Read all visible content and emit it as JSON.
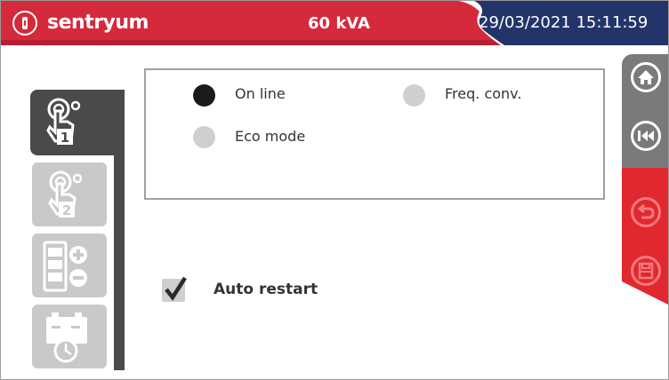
{
  "header": {
    "brand": "sentryum",
    "power": "60 kVA",
    "datetime": "29/03/2021 15:11:59"
  },
  "nav": {
    "items": [
      {
        "icon": "hand-touch-1-icon",
        "active": true
      },
      {
        "icon": "hand-touch-2-icon",
        "active": false
      },
      {
        "icon": "battery-plus-minus-icon",
        "active": false
      },
      {
        "icon": "battery-clock-icon",
        "active": false
      }
    ]
  },
  "mode": {
    "options": [
      {
        "label": "On line",
        "selected": true
      },
      {
        "label": "Freq. conv.",
        "selected": false
      },
      {
        "label": "Eco mode",
        "selected": false
      }
    ]
  },
  "auto_restart": {
    "label": "Auto restart",
    "checked": true
  },
  "side": {
    "buttons": [
      {
        "icon": "home-icon"
      },
      {
        "icon": "rewind-icon"
      },
      {
        "icon": "undo-icon"
      },
      {
        "icon": "save-icon"
      }
    ]
  },
  "colors": {
    "brand_red": "#d42a3c",
    "date_blue": "#22346a",
    "dark_grey": "#4a4a4a",
    "light_grey": "#cfcfcf"
  }
}
